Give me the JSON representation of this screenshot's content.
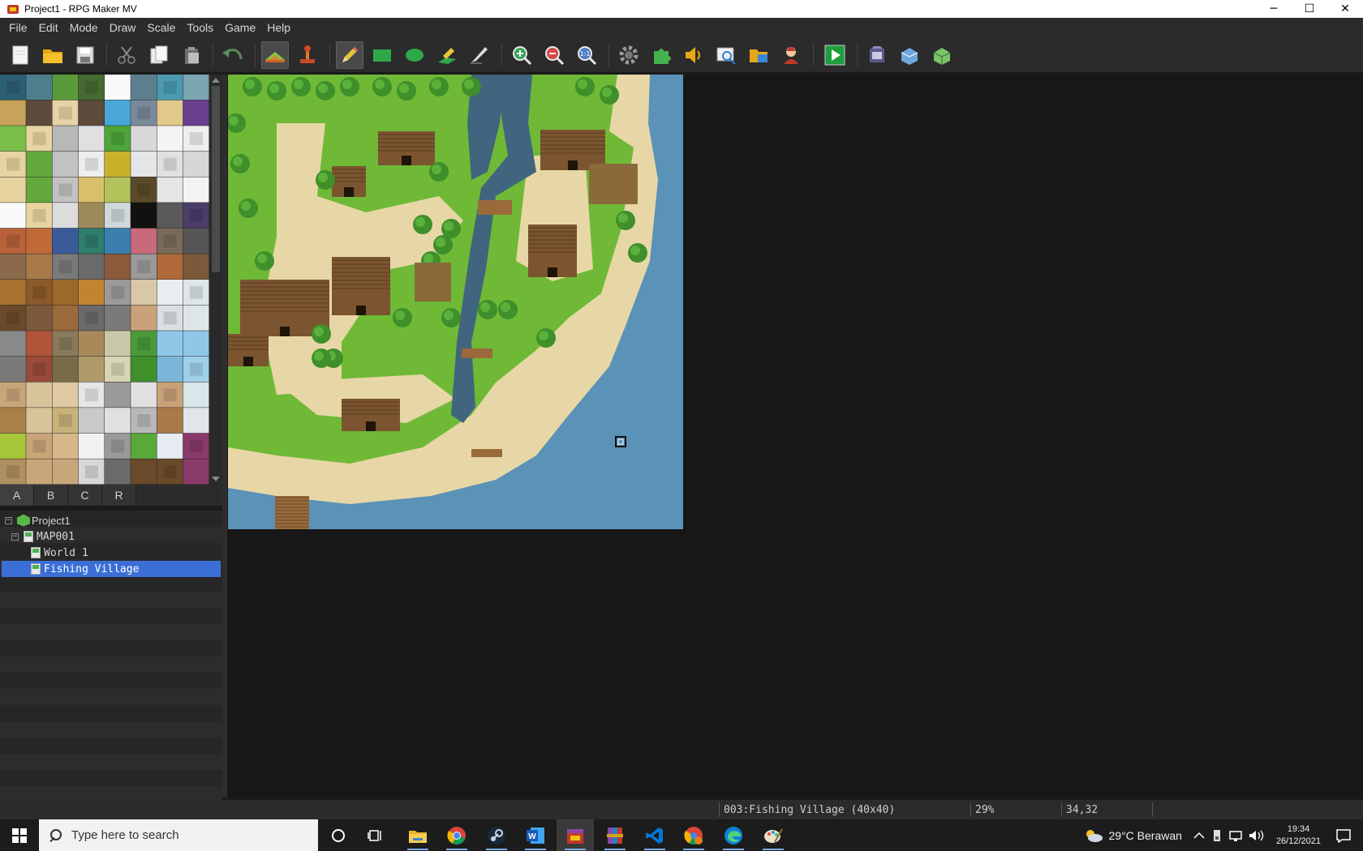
{
  "window": {
    "title": "Project1 - RPG Maker MV",
    "minimize": "─",
    "maximize": "☐",
    "close": "✕"
  },
  "menu": [
    "File",
    "Edit",
    "Mode",
    "Draw",
    "Scale",
    "Tools",
    "Game",
    "Help"
  ],
  "toolbar": {
    "groups": [
      [
        "new-project",
        "open-project",
        "save-project"
      ],
      [
        "cut",
        "copy",
        "paste"
      ],
      [
        "undo"
      ],
      [
        "map-mode",
        "event-mode"
      ],
      [
        "pencil",
        "rectangle",
        "ellipse",
        "flood-fill",
        "shadow-pen"
      ],
      [
        "zoom-in",
        "zoom-out",
        "actual-size"
      ],
      [
        "database",
        "plugin-manager",
        "sound-test",
        "event-searcher",
        "resource-manager",
        "character-generator"
      ],
      [
        "playtest"
      ],
      [
        "deployment",
        "open-folder",
        "rpg-maker-tools"
      ]
    ],
    "active": [
      "map-mode",
      "pencil"
    ]
  },
  "tileset_tabs": [
    "A",
    "B",
    "C",
    "R"
  ],
  "active_tab": "A",
  "map_tree": {
    "root": "Project1",
    "map": "MAP001",
    "children": [
      "World 1",
      "Fishing Village"
    ],
    "selected": "Fishing Village"
  },
  "status": {
    "map_info": "003:Fishing Village (40x40)",
    "zoom": "29%",
    "coords": "34,32"
  },
  "taskbar": {
    "search_placeholder": "Type here to search",
    "apps": [
      "cortana",
      "task-view",
      "file-explorer",
      "chrome",
      "steam",
      "word",
      "rpg-maker",
      "winrar",
      "vscode",
      "chrome-profile",
      "edge",
      "paint"
    ],
    "weather": "29°C  Berawan",
    "time": "19:34",
    "date": "26/12/2021"
  },
  "colors": {
    "grass": "#6fb936",
    "sand": "#e8d7a6",
    "water": "#5a92b8",
    "river": "#41657e",
    "wood": "#7b5530",
    "tree": "#3f8f2a",
    "selection": "#3b6fd6"
  }
}
